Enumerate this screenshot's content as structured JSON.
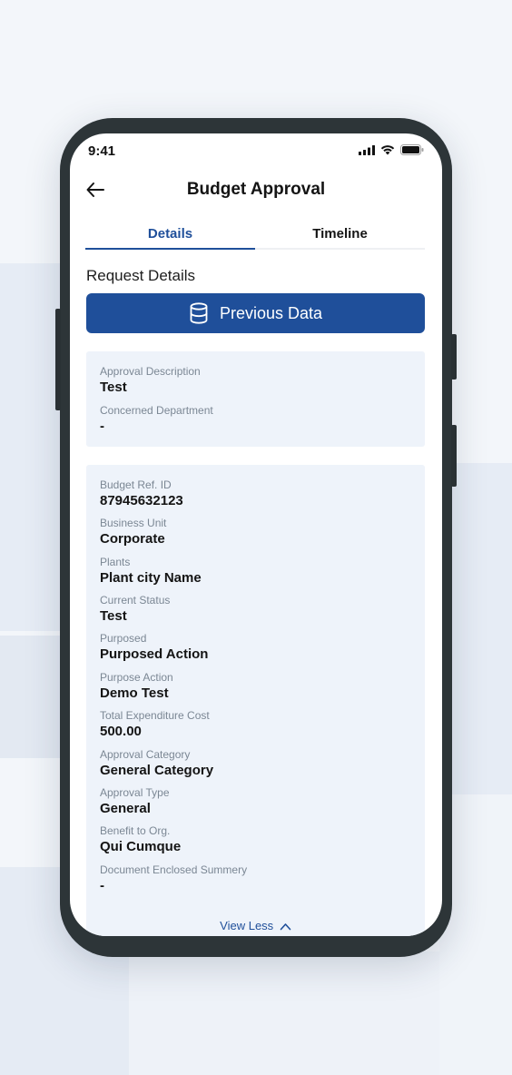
{
  "status": {
    "time": "9:41"
  },
  "header": {
    "title": "Budget Approval"
  },
  "tabs": [
    {
      "label": "Details"
    },
    {
      "label": "Timeline"
    }
  ],
  "section_title": "Request Details",
  "previous_data_button": {
    "label": "Previous Data",
    "icon": "database-icon"
  },
  "card1": {
    "fields": [
      {
        "label": "Approval Description",
        "value": "Test"
      },
      {
        "label": "Concerned Department",
        "value": "-"
      }
    ]
  },
  "card2": {
    "fields": [
      {
        "label": "Budget Ref. ID",
        "value": "87945632123"
      },
      {
        "label": "Business Unit",
        "value": "Corporate"
      },
      {
        "label": "Plants",
        "value": "Plant city Name"
      },
      {
        "label": "Current Status",
        "value": "Test"
      },
      {
        "label": "Purposed",
        "value": "Purposed Action"
      },
      {
        "label": "Purpose Action",
        "value": "Demo Test"
      },
      {
        "label": "Total Expenditure Cost",
        "value": "500.00"
      },
      {
        "label": "Approval Category",
        "value": "General Category"
      },
      {
        "label": "Approval Type",
        "value": "General"
      },
      {
        "label": "Benefit to Org.",
        "value": "Qui Cumque"
      },
      {
        "label": "Document Enclosed Summery",
        "value": "-"
      }
    ],
    "toggle_label": "View Less"
  },
  "colors": {
    "primary": "#1f4f9a",
    "card_bg": "#eef3fa",
    "phone_frame": "#2d3538"
  }
}
